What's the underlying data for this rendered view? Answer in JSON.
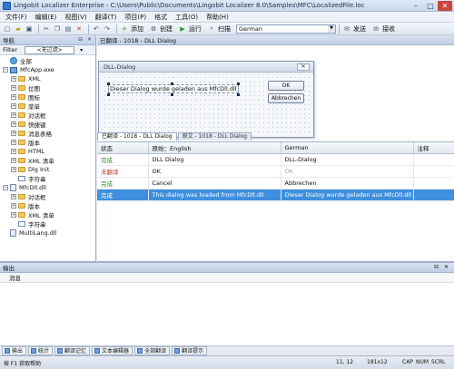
{
  "window": {
    "title": "Lingobit Localizer Enterprise - C:\\Users\\Public\\Documents\\Lingobit Localizer 8.0\\Samples\\MFC\\LocalizedFile.loc",
    "minimize": "–",
    "maximize": "□",
    "close": "✕"
  },
  "menu": [
    "文件(F)",
    "编辑(E)",
    "视图(V)",
    "翻译(T)",
    "项目(P)",
    "格式",
    "工具(O)",
    "帮助(H)"
  ],
  "toolbar": {
    "add_label": "添加",
    "create_label": "创建",
    "run_label": "运行",
    "scan_label": "扫描",
    "language_value": "German",
    "send_label": "发送",
    "receive_label": "接收"
  },
  "nav": {
    "title": "导航",
    "filter_label": "Filter",
    "filter_value": "<无过滤>",
    "tree": [
      {
        "label": "全部",
        "indent": 0,
        "icon": "globe",
        "expander": ""
      },
      {
        "label": "MfcApp.exe",
        "indent": 0,
        "icon": "app",
        "expander": "−"
      },
      {
        "label": "XML",
        "indent": 1,
        "icon": "folder",
        "expander": "+"
      },
      {
        "label": "位图",
        "indent": 1,
        "icon": "folder",
        "expander": "+"
      },
      {
        "label": "图标",
        "indent": 1,
        "icon": "folder",
        "expander": "+"
      },
      {
        "label": "菜单",
        "indent": 1,
        "icon": "folder",
        "expander": "+"
      },
      {
        "label": "对话框",
        "indent": 1,
        "icon": "folder",
        "expander": "+"
      },
      {
        "label": "快捷键",
        "indent": 1,
        "icon": "folder",
        "expander": "+"
      },
      {
        "label": "消息表格",
        "indent": 1,
        "icon": "folder",
        "expander": "+"
      },
      {
        "label": "版本",
        "indent": 1,
        "icon": "folder",
        "expander": "+"
      },
      {
        "label": "HTML",
        "indent": 1,
        "icon": "folder",
        "expander": "+"
      },
      {
        "label": "XML 清单",
        "indent": 1,
        "icon": "folder",
        "expander": "+"
      },
      {
        "label": "Dlg Init",
        "indent": 1,
        "icon": "folder",
        "expander": "+"
      },
      {
        "label": "字符串",
        "indent": 1,
        "icon": "string",
        "expander": ""
      },
      {
        "label": "MfcDll.dll",
        "indent": 0,
        "icon": "dll",
        "expander": "−"
      },
      {
        "label": "对话框",
        "indent": 1,
        "icon": "folder",
        "expander": "+"
      },
      {
        "label": "版本",
        "indent": 1,
        "icon": "folder",
        "expander": "+"
      },
      {
        "label": "XML 清单",
        "indent": 1,
        "icon": "folder",
        "expander": "+"
      },
      {
        "label": "字符串",
        "indent": 1,
        "icon": "string",
        "expander": ""
      },
      {
        "label": "MultiLang.dll",
        "indent": 0,
        "icon": "dll",
        "expander": ""
      }
    ]
  },
  "editor": {
    "header": "已翻译 - 1018 - DLL Dialog",
    "dialog_title": "DLL-Dialog",
    "dialog_close": "✕",
    "dialog_text": "Dieser Dialog wurde geladen aus MfcDll.dll",
    "ok_label": "OK",
    "cancel_label": "Abbrechen"
  },
  "view_tabs": [
    "已翻译 - 1018 - DLL Dialog",
    "原文 - 1018 - DLL Dialog"
  ],
  "grid": {
    "columns": [
      "状态",
      "原始：English",
      "German",
      "注释"
    ],
    "rows": [
      {
        "status": "完成",
        "status_type": "done",
        "source": "DLL Dialog",
        "target": "DLL-Dialog",
        "note": ""
      },
      {
        "status": "未翻译",
        "status_type": "untranslated",
        "source": "OK",
        "target": "OK",
        "note": ""
      },
      {
        "status": "完成",
        "status_type": "done",
        "source": "Cancel",
        "target": "Abbrechen",
        "note": ""
      },
      {
        "status": "完成",
        "status_type": "done",
        "source": "This dialog was loaded from MfcDll.dll",
        "target": "Dieser Dialog wurde geladen aus MfcDll.dll",
        "note": ""
      }
    ],
    "selected_row": 3
  },
  "output": {
    "title": "输出",
    "column": "消息"
  },
  "bottom_tabs": [
    "输出",
    "统计",
    "翻译记忆",
    "文本编辑器",
    "全部翻译",
    "翻译提示"
  ],
  "status": {
    "help": "按 F1 获取帮助",
    "position": "11, 12",
    "size": "181x12",
    "cap": "CAP",
    "num": "NUM",
    "scrl": "SCRL"
  },
  "colors": {
    "done": "#2f8f2f",
    "untranslated": "#c0392b",
    "selection": "#3f8fde"
  }
}
